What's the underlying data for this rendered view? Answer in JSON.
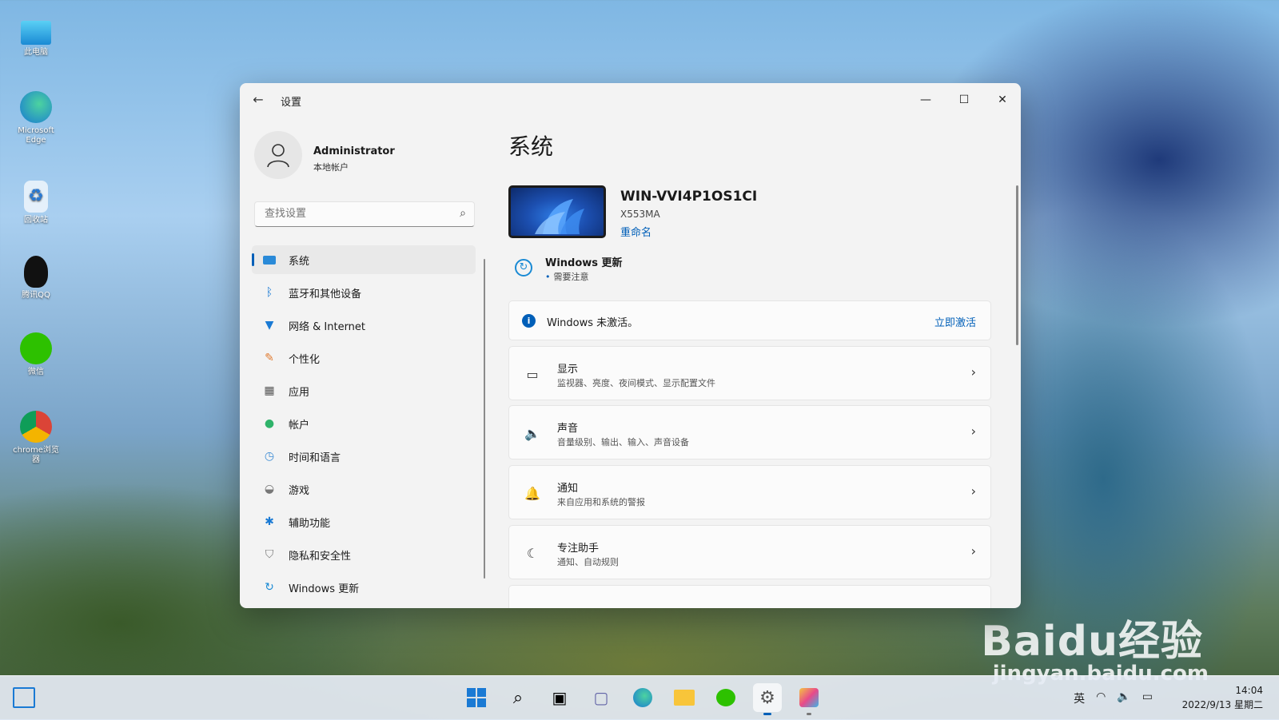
{
  "desktop": {
    "icons": [
      {
        "label": "此电脑",
        "icon": "monitor-icon"
      },
      {
        "label": "Microsoft Edge",
        "icon": "edge-icon"
      },
      {
        "label": "回收站",
        "icon": "recycle-bin-icon"
      },
      {
        "label": "腾讯QQ",
        "icon": "qq-icon"
      },
      {
        "label": "微信",
        "icon": "wechat-icon"
      },
      {
        "label": "chrome浏览器",
        "icon": "chrome-icon"
      }
    ],
    "watermark": "Baidu经验",
    "watermark_url": "jingyan.baidu.com"
  },
  "window": {
    "title": "设置",
    "back_icon": "arrow-left-icon",
    "caption": {
      "minimize": "—",
      "maximize": "☐",
      "close": "✕"
    }
  },
  "sidebar": {
    "user": {
      "name": "Administrator",
      "account_type": "本地帐户"
    },
    "search": {
      "placeholder": "查找设置"
    },
    "items": [
      {
        "label": "系统",
        "icon": "system-icon",
        "active": true
      },
      {
        "label": "蓝牙和其他设备",
        "icon": "bluetooth-icon"
      },
      {
        "label": "网络 & Internet",
        "icon": "wifi-icon"
      },
      {
        "label": "个性化",
        "icon": "brush-icon"
      },
      {
        "label": "应用",
        "icon": "apps-icon"
      },
      {
        "label": "帐户",
        "icon": "account-icon"
      },
      {
        "label": "时间和语言",
        "icon": "clock-globe-icon"
      },
      {
        "label": "游戏",
        "icon": "gamepad-icon"
      },
      {
        "label": "辅助功能",
        "icon": "accessibility-icon"
      },
      {
        "label": "隐私和安全性",
        "icon": "shield-icon"
      },
      {
        "label": "Windows 更新",
        "icon": "windows-update-icon"
      }
    ]
  },
  "main": {
    "title": "系统",
    "device": {
      "name": "WIN-VVI4P1OS1CI",
      "model": "X553MA",
      "rename": "重命名"
    },
    "update": {
      "title": "Windows 更新",
      "status": "需要注意"
    },
    "activation": {
      "text": "Windows 未激活。",
      "link": "立即激活"
    },
    "rows": [
      {
        "title": "显示",
        "subtitle": "监视器、亮度、夜间模式、显示配置文件",
        "icon": "display-icon"
      },
      {
        "title": "声音",
        "subtitle": "音量级别、输出、输入、声音设备",
        "icon": "speaker-icon"
      },
      {
        "title": "通知",
        "subtitle": "来自应用和系统的警报",
        "icon": "bell-icon"
      },
      {
        "title": "专注助手",
        "subtitle": "通知、自动规则",
        "icon": "moon-icon"
      }
    ]
  },
  "taskbar": {
    "apps": [
      "start-icon",
      "search-icon",
      "task-view-icon",
      "teams-chat-icon",
      "edge-icon",
      "file-explorer-icon",
      "wechat-icon",
      "settings-icon",
      "paint-icon"
    ],
    "tray": {
      "ime": "英"
    },
    "clock": {
      "time": "14:04",
      "date": "2022/9/13 星期二"
    }
  }
}
